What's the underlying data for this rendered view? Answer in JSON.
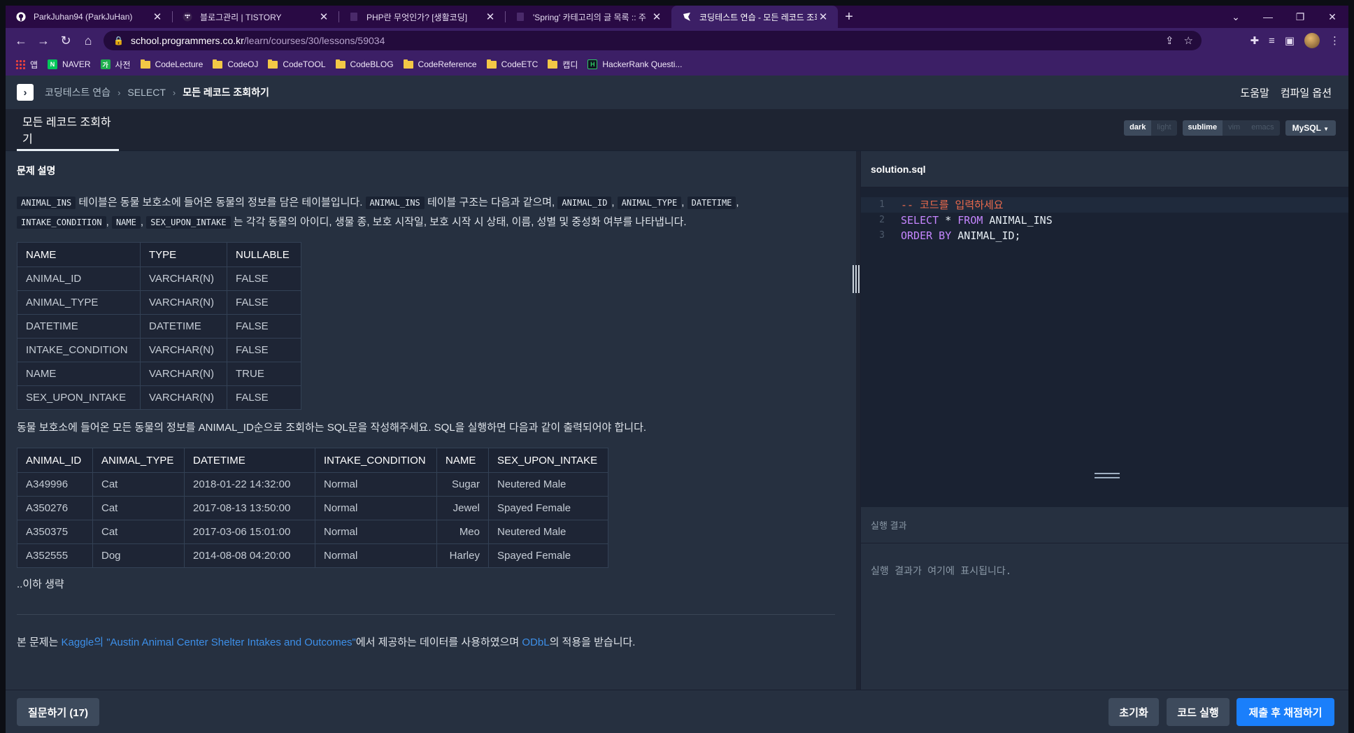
{
  "browser": {
    "tabs": [
      {
        "title": "ParkJuhan94 (ParkJuHan)",
        "icon": "github-icon",
        "active": false
      },
      {
        "title": "블로그관리 | TISTORY",
        "icon": "tistory-icon",
        "active": false
      },
      {
        "title": "PHP란 무엇인가? [생활코딩]",
        "icon": "page-icon",
        "active": false
      },
      {
        "title": "'Spring' 카테고리의 글 목록 :: 주",
        "icon": "page-icon",
        "active": false
      },
      {
        "title": "코딩테스트 연습 - 모든 레코드 조회",
        "icon": "programmers-icon",
        "active": true
      }
    ],
    "url_host": "school.programmers.co.kr",
    "url_path": "/learn/courses/30/lessons/59034",
    "bookmarks": [
      {
        "label": "앱",
        "icon": "apps-grid-icon"
      },
      {
        "label": "NAVER",
        "icon": "naver-icon"
      },
      {
        "label": "사전",
        "icon": "dictionary-icon"
      },
      {
        "label": "CodeLecture",
        "icon": "folder-icon"
      },
      {
        "label": "CodeOJ",
        "icon": "folder-icon"
      },
      {
        "label": "CodeTOOL",
        "icon": "folder-icon"
      },
      {
        "label": "CodeBLOG",
        "icon": "folder-icon"
      },
      {
        "label": "CodeReference",
        "icon": "folder-icon"
      },
      {
        "label": "CodeETC",
        "icon": "folder-icon"
      },
      {
        "label": "캡디",
        "icon": "folder-icon"
      },
      {
        "label": "HackerRank Questi...",
        "icon": "hackerrank-icon"
      }
    ]
  },
  "header": {
    "breadcrumb": [
      "코딩테스트 연습",
      "SELECT",
      "모든 레코드 조회하기"
    ],
    "help": "도움말",
    "compile_options": "컴파일 옵션"
  },
  "lesson": {
    "tab_title": "모든 레코드 조회하기",
    "theme_options": [
      "dark",
      "light"
    ],
    "theme_selected": "dark",
    "keymap_options": [
      "sublime",
      "vim",
      "emacs"
    ],
    "keymap_selected": "sublime",
    "language": "MySQL"
  },
  "problem": {
    "section_title": "문제 설명",
    "p1": {
      "c1": "ANIMAL_INS",
      "t1": " 테이블은 동물 보호소에 들어온 동물의 정보를 담은 테이블입니다. ",
      "c2": "ANIMAL_INS",
      "t2": " 테이블 구조는 다음과 같으며, ",
      "c3": "ANIMAL_ID",
      "s1": ", ",
      "c4": "ANIMAL_TYPE",
      "s2": ", ",
      "c5": "DATETIME",
      "s3": ",",
      "c6": "INTAKE_CONDITION",
      "s4": ", ",
      "c7": "NAME",
      "s5": ", ",
      "c8": "SEX_UPON_INTAKE",
      "t3": " 는 각각 동물의 아이디, 생물 종, 보호 시작일, 보호 시작 시 상태, 이름, 성별 및 중성화 여부를 나타냅니다."
    },
    "schema_table": {
      "headers": [
        "NAME",
        "TYPE",
        "NULLABLE"
      ],
      "rows": [
        [
          "ANIMAL_ID",
          "VARCHAR(N)",
          "FALSE"
        ],
        [
          "ANIMAL_TYPE",
          "VARCHAR(N)",
          "FALSE"
        ],
        [
          "DATETIME",
          "DATETIME",
          "FALSE"
        ],
        [
          "INTAKE_CONDITION",
          "VARCHAR(N)",
          "FALSE"
        ],
        [
          "NAME",
          "VARCHAR(N)",
          "TRUE"
        ],
        [
          "SEX_UPON_INTAKE",
          "VARCHAR(N)",
          "FALSE"
        ]
      ]
    },
    "p2": "동물 보호소에 들어온 모든 동물의 정보를 ANIMAL_ID순으로 조회하는 SQL문을 작성해주세요. SQL을 실행하면 다음과 같이 출력되어야 합니다.",
    "example_table": {
      "headers": [
        "ANIMAL_ID",
        "ANIMAL_TYPE",
        "DATETIME",
        "INTAKE_CONDITION",
        "NAME",
        "SEX_UPON_INTAKE"
      ],
      "rows": [
        [
          "A349996",
          "Cat",
          "2018-01-22 14:32:00",
          "Normal",
          "Sugar",
          "Neutered Male"
        ],
        [
          "A350276",
          "Cat",
          "2017-08-13 13:50:00",
          "Normal",
          "Jewel",
          "Spayed Female"
        ],
        [
          "A350375",
          "Cat",
          "2017-03-06 15:01:00",
          "Normal",
          "Meo",
          "Neutered Male"
        ],
        [
          "A352555",
          "Dog",
          "2014-08-08 04:20:00",
          "Normal",
          "Harley",
          "Spayed Female"
        ]
      ]
    },
    "omitted": "..이하 생략",
    "footnote": {
      "prefix": "본 문제는 ",
      "link1": "Kaggle의 \"Austin Animal Center Shelter Intakes and Outcomes\"",
      "middle": "에서 제공하는 데이터를 사용하였으며 ",
      "link2": "ODbL",
      "suffix": "의 적용을 받습니다."
    }
  },
  "editor": {
    "filename": "solution.sql",
    "line_numbers": [
      "1",
      "2",
      "3"
    ],
    "line1_comment": "-- 코드를 입력하세요",
    "line2_kw1": "SELECT",
    "line2_rest1": " * ",
    "line2_kw2": "FROM",
    "line2_rest2": " ANIMAL_INS",
    "line3_kw": "ORDER BY",
    "line3_rest": " ANIMAL_ID;"
  },
  "result": {
    "title": "실행 결과",
    "placeholder": "실행 결과가 여기에 표시됩니다."
  },
  "footer": {
    "question_button": "질문하기 (17)",
    "reset_button": "초기화",
    "run_button": "코드 실행",
    "submit_button": "제출 후 채점하기"
  }
}
